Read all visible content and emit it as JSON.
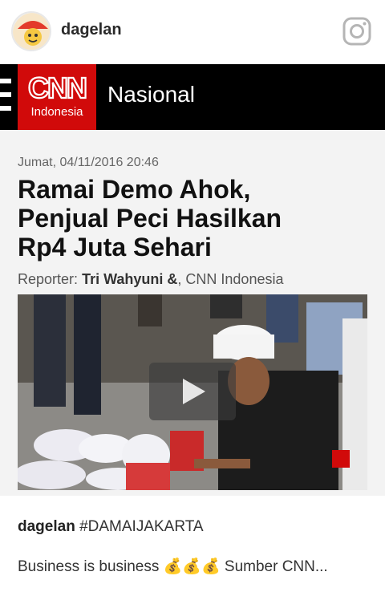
{
  "header": {
    "username": "dagelan",
    "icon": "instagram-icon"
  },
  "article": {
    "logo_text": "CNN",
    "logo_subtext": "Indonesia",
    "section": "Nasional",
    "date": "Jumat, 04/11/2016 20:46",
    "title_lines": [
      "Ramai Demo Ahok,",
      "Penjual Peci Hasilkan",
      "Rp4 Juta Sehari"
    ],
    "reporter_label": "Reporter:",
    "reporter_name": "Tri Wahyuni &",
    "reporter_suffix": ", CNN Indonesia",
    "video_icon": "play-icon"
  },
  "caption": {
    "username": "dagelan",
    "hashtag": "#DAMAIJAKARTA",
    "text": "Business is business 💰💰💰 Sumber CNN..."
  },
  "colors": {
    "cnn_red": "#d10a0a",
    "bar_black": "#000000"
  }
}
